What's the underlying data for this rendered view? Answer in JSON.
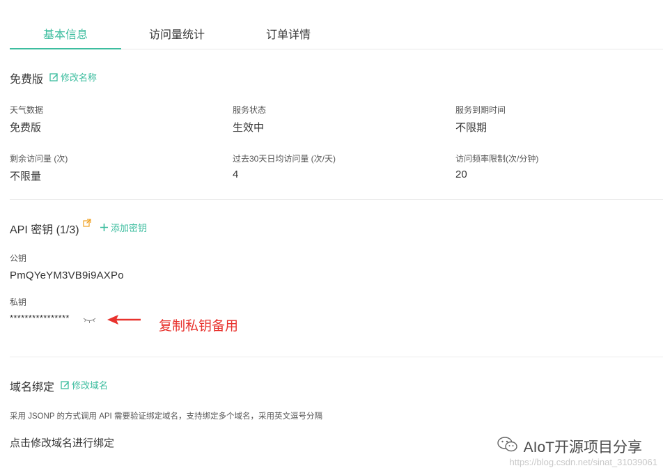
{
  "tabs": [
    {
      "label": "基本信息",
      "active": true
    },
    {
      "label": "访问量统计",
      "active": false
    },
    {
      "label": "订单详情",
      "active": false
    }
  ],
  "plan": {
    "title": "免费版",
    "rename_label": "修改名称",
    "fields": [
      {
        "label": "天气数据",
        "value": "免费版"
      },
      {
        "label": "服务状态",
        "value": "生效中"
      },
      {
        "label": "服务到期时间",
        "value": "不限期"
      },
      {
        "label": "剩余访问量 (次)",
        "value": "不限量"
      },
      {
        "label": "过去30天日均访问量 (次/天)",
        "value": "4"
      },
      {
        "label": "访问频率限制(次/分钟)",
        "value": "20"
      }
    ]
  },
  "api": {
    "title": "API 密钥 (1/3)",
    "add_label": "添加密钥",
    "public_key_label": "公钥",
    "public_key_value": "PmQYeYM3VB9i9AXPo",
    "private_key_label": "私钥",
    "private_key_value": "****************"
  },
  "annotation": {
    "text": "复制私钥备用",
    "color": "#e8322d"
  },
  "domain": {
    "title": "域名绑定",
    "edit_label": "修改域名",
    "description": "采用 JSONP 的方式调用 API 需要验证绑定域名，支持绑定多个域名，采用英文逗号分隔",
    "bind_prompt": "点击修改域名进行绑定"
  },
  "watermark": {
    "text": "AIoT开源项目分享",
    "url": "https://blog.csdn.net/sinat_31039061"
  },
  "colors": {
    "accent": "#3dbd9f",
    "external_icon": "#f0a020"
  }
}
